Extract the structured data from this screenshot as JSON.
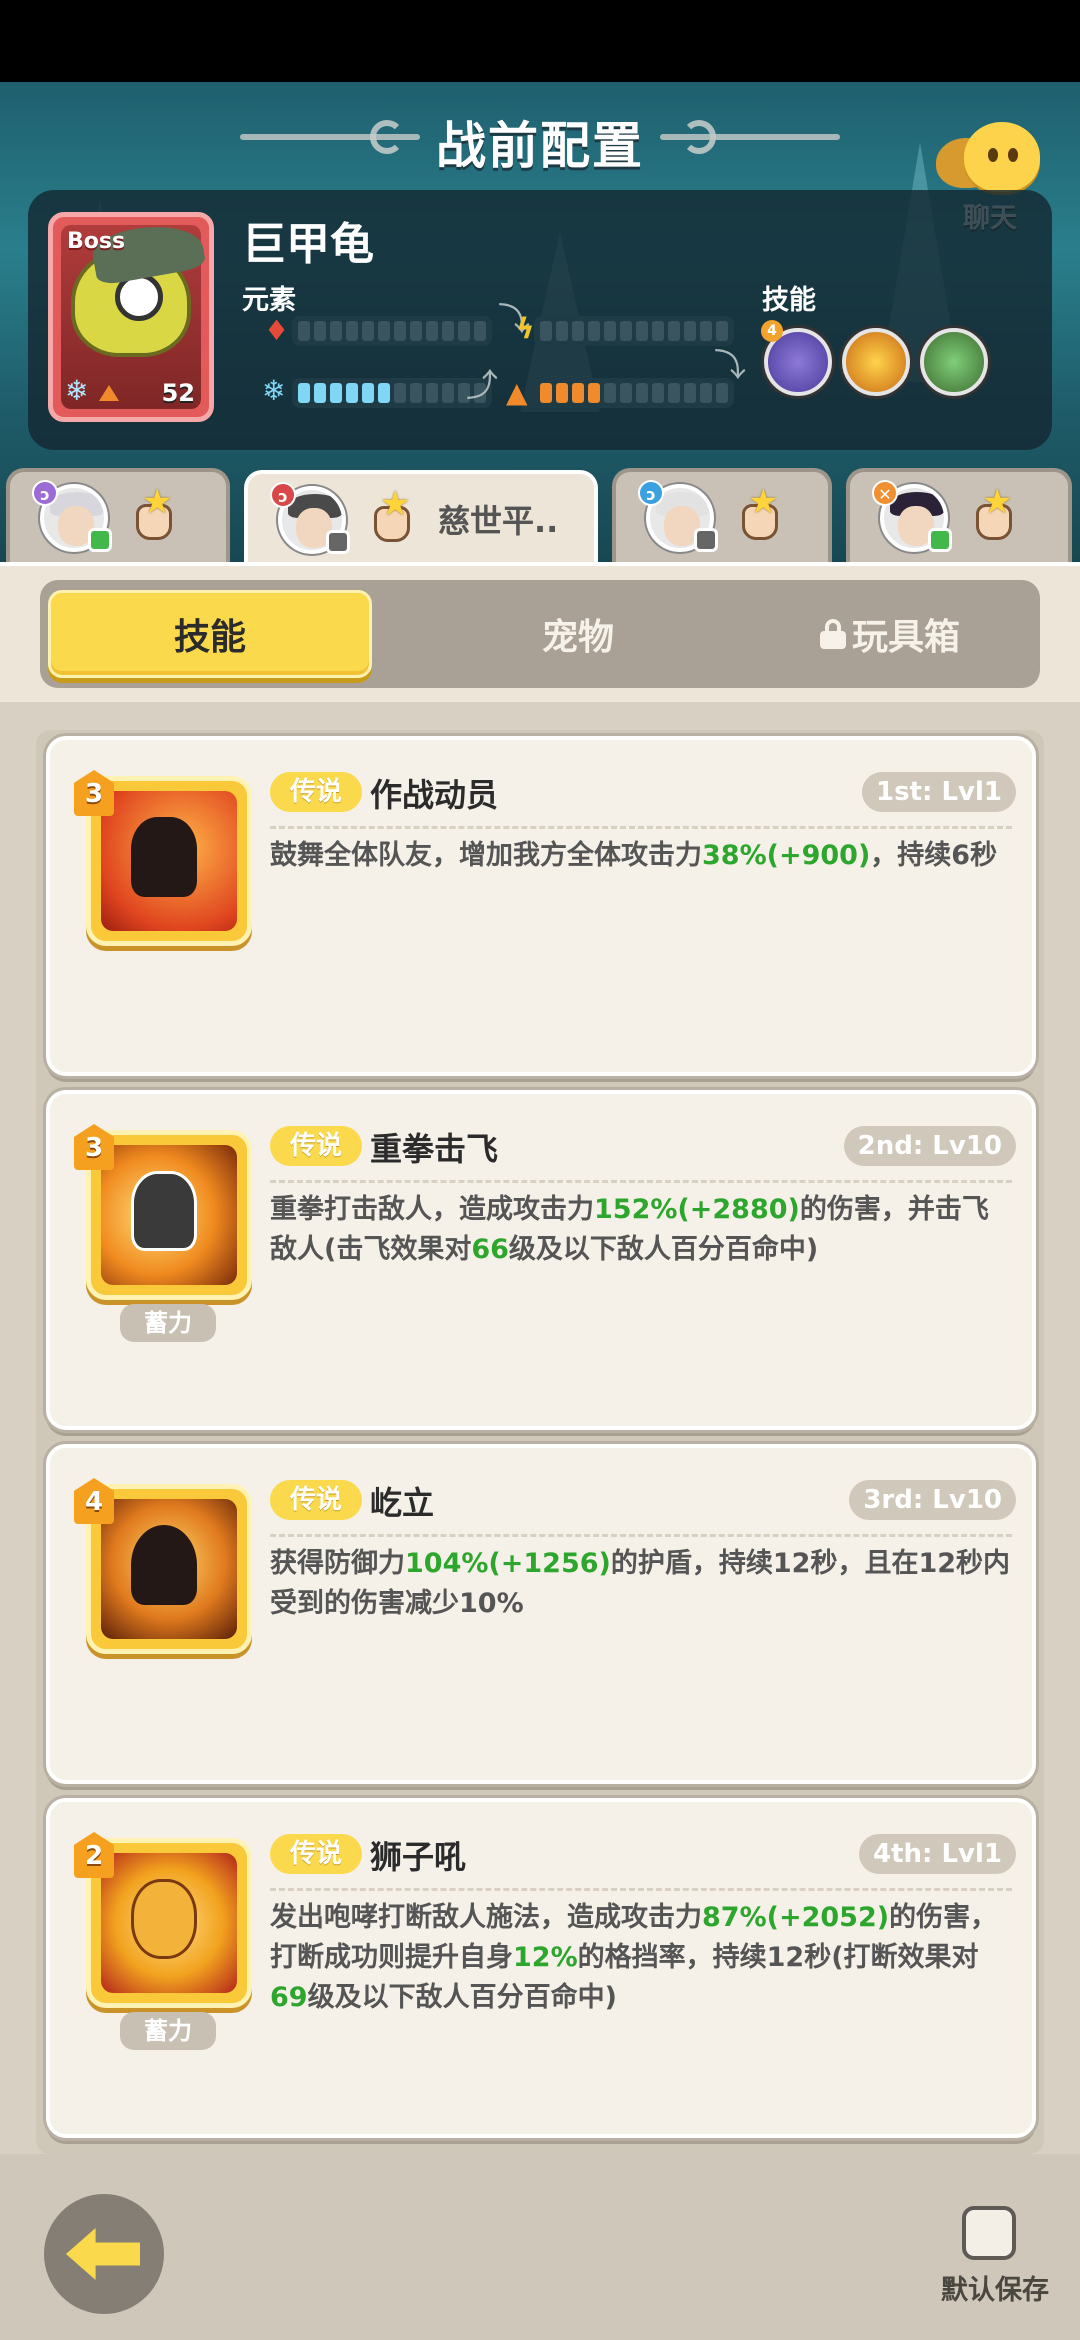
{
  "header": {
    "title": "战前配置",
    "chat_label": "聊天"
  },
  "boss": {
    "badge": "Boss",
    "name": "巨甲龟",
    "level": "52",
    "element_label": "元素",
    "skill_label": "技能",
    "skill_orb_count": "4",
    "elements": [
      {
        "icon": "fire-icon",
        "color": "#e84a3a",
        "filled": 0
      },
      {
        "icon": "lightning-icon",
        "color": "#f3c52a",
        "filled": 0
      },
      {
        "icon": "ice-icon",
        "color": "#7fd7f5",
        "filled": 6
      },
      {
        "icon": "earth-icon",
        "color": "#f08a2a",
        "filled": 4
      }
    ]
  },
  "heroes": [
    {
      "name": "",
      "element_color": "#9b6bd6",
      "status_color": "#43b84a"
    },
    {
      "name": "慈世平..",
      "element_color": "#d84848",
      "status_color": "#666666"
    },
    {
      "name": "",
      "element_color": "#3aa0e0",
      "status_color": "#666666"
    },
    {
      "name": "",
      "element_color": "#f09030",
      "status_color": "#43b84a"
    }
  ],
  "tabs": {
    "skills": "技能",
    "pets": "宠物",
    "toybox": "玩具箱"
  },
  "skills": [
    {
      "level": "3",
      "rarity": "传说",
      "name": "作战动员",
      "slot": "1st: Lvl1",
      "charge": "",
      "desc_parts": [
        "鼓舞全体队友，增加我方全体攻击力",
        "38%(+900)",
        "，持续6秒"
      ]
    },
    {
      "level": "3",
      "rarity": "传说",
      "name": "重拳击飞",
      "slot": "2nd: Lv10",
      "charge": "蓄力",
      "desc_parts": [
        "重拳打击敌人，造成攻击力",
        "152%(+2880)",
        "的伤害，并击飞敌人(击飞效果对",
        "66",
        "级及以下敌人百分百命中)"
      ]
    },
    {
      "level": "4",
      "rarity": "传说",
      "name": "屹立",
      "slot": "3rd: Lv10",
      "charge": "",
      "desc_parts": [
        "获得防御力",
        "104%(+1256)",
        "的护盾，持续12秒，且在12秒内受到的伤害减少10%"
      ]
    },
    {
      "level": "2",
      "rarity": "传说",
      "name": "狮子吼",
      "slot": "4th: Lvl1",
      "charge": "蓄力",
      "desc_parts": [
        "发出咆哮打断敌人施法，造成攻击力",
        "87%(+2052)",
        "的伤害，打断成功则提升自身",
        "12%",
        "的格挡率，持续12秒(打断效果对",
        "69",
        "级及以下敌人百分百命中)"
      ]
    }
  ],
  "footer": {
    "save_label": "默认保存"
  }
}
